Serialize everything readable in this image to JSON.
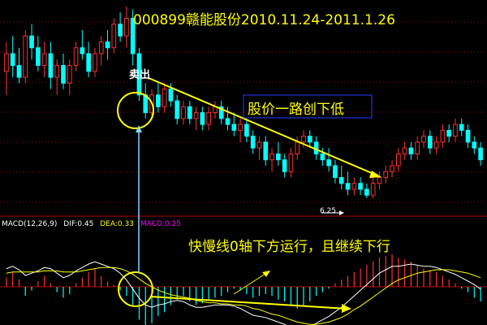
{
  "colors": {
    "background": "#000000",
    "up": "#ff3030",
    "down": "#00ffff",
    "grid": "#9b0000",
    "divider": "#b00000",
    "annotation_yellow": "#ffff00",
    "dif": "#ffffff",
    "dea": "#ffff00",
    "macd": "#ff00ff",
    "low_marker": "#ffffff",
    "vertical_link": "#7fd8ff"
  },
  "annotations": {
    "title": "000899赣能股份2010.11.24-2011.1.26",
    "sell_label": "卖出",
    "trend_label": "股价一路创下低",
    "macd_note": "快慢线0轴下方运行，且继续下行",
    "low_marker": "6.25"
  },
  "macd_header": {
    "name": "MACD(12,26,9)",
    "dif": "DIF:0.45",
    "dea": "DEA:0.33",
    "macd": "MACD:0.25"
  },
  "chart_data": [
    {
      "type": "candlestick",
      "title": "000899赣能股份2010.11.24-2011.1.26",
      "ylim": [
        6.0,
        9.5
      ],
      "annotations": [
        "卖出",
        "股价一路创下低",
        "6.25"
      ],
      "candles": [
        {
          "o": 8.4,
          "h": 8.9,
          "l": 8.0,
          "c": 8.7
        },
        {
          "o": 8.7,
          "h": 9.0,
          "l": 8.3,
          "c": 8.5
        },
        {
          "o": 8.5,
          "h": 8.8,
          "l": 8.2,
          "c": 8.3
        },
        {
          "o": 8.3,
          "h": 9.1,
          "l": 8.2,
          "c": 9.0
        },
        {
          "o": 9.0,
          "h": 9.2,
          "l": 8.6,
          "c": 8.8
        },
        {
          "o": 8.8,
          "h": 9.0,
          "l": 8.4,
          "c": 8.5
        },
        {
          "o": 8.5,
          "h": 8.9,
          "l": 8.3,
          "c": 8.7
        },
        {
          "o": 8.7,
          "h": 8.9,
          "l": 8.1,
          "c": 8.3
        },
        {
          "o": 8.3,
          "h": 8.6,
          "l": 8.0,
          "c": 8.5
        },
        {
          "o": 8.5,
          "h": 8.7,
          "l": 8.1,
          "c": 8.2
        },
        {
          "o": 8.2,
          "h": 8.6,
          "l": 8.0,
          "c": 8.5
        },
        {
          "o": 8.5,
          "h": 8.9,
          "l": 8.4,
          "c": 8.8
        },
        {
          "o": 8.8,
          "h": 9.1,
          "l": 8.6,
          "c": 8.7
        },
        {
          "o": 8.7,
          "h": 8.9,
          "l": 8.3,
          "c": 8.4
        },
        {
          "o": 8.4,
          "h": 8.8,
          "l": 8.3,
          "c": 8.7
        },
        {
          "o": 8.7,
          "h": 9.0,
          "l": 8.5,
          "c": 8.9
        },
        {
          "o": 8.9,
          "h": 9.1,
          "l": 8.6,
          "c": 8.8
        },
        {
          "o": 8.8,
          "h": 9.3,
          "l": 8.7,
          "c": 9.2
        },
        {
          "o": 9.2,
          "h": 9.4,
          "l": 8.9,
          "c": 9.0
        },
        {
          "o": 9.0,
          "h": 9.5,
          "l": 8.8,
          "c": 9.3
        },
        {
          "o": 9.3,
          "h": 9.45,
          "l": 8.5,
          "c": 8.7
        },
        {
          "o": 8.7,
          "h": 8.8,
          "l": 7.9,
          "c": 8.0
        },
        {
          "o": 8.0,
          "h": 8.2,
          "l": 7.6,
          "c": 7.7
        },
        {
          "o": 7.7,
          "h": 8.1,
          "l": 7.6,
          "c": 8.0
        },
        {
          "o": 8.0,
          "h": 8.2,
          "l": 7.7,
          "c": 7.8
        },
        {
          "o": 7.8,
          "h": 8.2,
          "l": 7.7,
          "c": 8.1
        },
        {
          "o": 8.1,
          "h": 8.2,
          "l": 7.8,
          "c": 7.9
        },
        {
          "o": 7.9,
          "h": 8.0,
          "l": 7.5,
          "c": 7.6
        },
        {
          "o": 7.6,
          "h": 7.9,
          "l": 7.5,
          "c": 7.8
        },
        {
          "o": 7.8,
          "h": 7.9,
          "l": 7.5,
          "c": 7.6
        },
        {
          "o": 7.6,
          "h": 7.8,
          "l": 7.4,
          "c": 7.7
        },
        {
          "o": 7.7,
          "h": 7.8,
          "l": 7.4,
          "c": 7.5
        },
        {
          "o": 7.5,
          "h": 7.8,
          "l": 7.4,
          "c": 7.7
        },
        {
          "o": 7.7,
          "h": 7.9,
          "l": 7.6,
          "c": 7.8
        },
        {
          "o": 7.8,
          "h": 7.9,
          "l": 7.5,
          "c": 7.6
        },
        {
          "o": 7.6,
          "h": 7.8,
          "l": 7.4,
          "c": 7.5
        },
        {
          "o": 7.5,
          "h": 7.7,
          "l": 7.3,
          "c": 7.4
        },
        {
          "o": 7.4,
          "h": 7.6,
          "l": 7.2,
          "c": 7.5
        },
        {
          "o": 7.5,
          "h": 7.6,
          "l": 7.2,
          "c": 7.3
        },
        {
          "o": 7.3,
          "h": 7.4,
          "l": 7.0,
          "c": 7.1
        },
        {
          "o": 7.1,
          "h": 7.3,
          "l": 6.9,
          "c": 7.2
        },
        {
          "o": 7.2,
          "h": 7.3,
          "l": 6.8,
          "c": 6.9
        },
        {
          "o": 6.9,
          "h": 7.1,
          "l": 6.7,
          "c": 7.0
        },
        {
          "o": 7.0,
          "h": 7.2,
          "l": 6.8,
          "c": 6.9
        },
        {
          "o": 6.9,
          "h": 7.0,
          "l": 6.6,
          "c": 6.7
        },
        {
          "o": 6.7,
          "h": 7.1,
          "l": 6.6,
          "c": 7.0
        },
        {
          "o": 7.0,
          "h": 7.3,
          "l": 6.9,
          "c": 7.2
        },
        {
          "o": 7.2,
          "h": 7.4,
          "l": 7.1,
          "c": 7.3
        },
        {
          "o": 7.3,
          "h": 7.4,
          "l": 7.1,
          "c": 7.2
        },
        {
          "o": 7.2,
          "h": 7.3,
          "l": 6.9,
          "c": 7.0
        },
        {
          "o": 7.0,
          "h": 7.1,
          "l": 6.8,
          "c": 6.9
        },
        {
          "o": 6.9,
          "h": 7.1,
          "l": 6.7,
          "c": 6.8
        },
        {
          "o": 6.8,
          "h": 6.9,
          "l": 6.5,
          "c": 6.6
        },
        {
          "o": 6.6,
          "h": 6.8,
          "l": 6.4,
          "c": 6.5
        },
        {
          "o": 6.5,
          "h": 6.7,
          "l": 6.3,
          "c": 6.4
        },
        {
          "o": 6.4,
          "h": 6.6,
          "l": 6.3,
          "c": 6.5
        },
        {
          "o": 6.5,
          "h": 6.6,
          "l": 6.3,
          "c": 6.4
        },
        {
          "o": 6.4,
          "h": 6.5,
          "l": 6.25,
          "c": 6.3
        },
        {
          "o": 6.3,
          "h": 6.6,
          "l": 6.25,
          "c": 6.5
        },
        {
          "o": 6.5,
          "h": 6.7,
          "l": 6.4,
          "c": 6.6
        },
        {
          "o": 6.6,
          "h": 6.8,
          "l": 6.5,
          "c": 6.7
        },
        {
          "o": 6.7,
          "h": 6.9,
          "l": 6.6,
          "c": 6.8
        },
        {
          "o": 6.8,
          "h": 7.1,
          "l": 6.7,
          "c": 7.0
        },
        {
          "o": 7.0,
          "h": 7.2,
          "l": 6.9,
          "c": 7.1
        },
        {
          "o": 7.1,
          "h": 7.2,
          "l": 6.9,
          "c": 7.0
        },
        {
          "o": 7.0,
          "h": 7.3,
          "l": 6.9,
          "c": 7.2
        },
        {
          "o": 7.2,
          "h": 7.4,
          "l": 7.1,
          "c": 7.3
        },
        {
          "o": 7.3,
          "h": 7.4,
          "l": 7.0,
          "c": 7.1
        },
        {
          "o": 7.1,
          "h": 7.3,
          "l": 7.0,
          "c": 7.2
        },
        {
          "o": 7.2,
          "h": 7.5,
          "l": 7.1,
          "c": 7.4
        },
        {
          "o": 7.4,
          "h": 7.5,
          "l": 7.2,
          "c": 7.3
        },
        {
          "o": 7.3,
          "h": 7.6,
          "l": 7.2,
          "c": 7.5
        },
        {
          "o": 7.5,
          "h": 7.6,
          "l": 7.3,
          "c": 7.4
        },
        {
          "o": 7.4,
          "h": 7.5,
          "l": 7.1,
          "c": 7.2
        },
        {
          "o": 7.2,
          "h": 7.3,
          "l": 7.0,
          "c": 7.1
        },
        {
          "o": 7.1,
          "h": 7.2,
          "l": 6.8,
          "c": 6.9
        }
      ]
    },
    {
      "type": "bar",
      "title": "MACD(12,26,9)",
      "annotations": [
        "快慢线0轴下方运行，且继续下行"
      ],
      "ylim": [
        -0.45,
        0.45
      ],
      "macd": [
        0.05,
        0.08,
        0.04,
        -0.05,
        -0.02,
        0.03,
        0.06,
        0.02,
        -0.03,
        -0.06,
        -0.04,
        0.02,
        0.05,
        0.08,
        0.1,
        0.06,
        0.03,
        0.01,
        -0.02,
        -0.05,
        -0.1,
        -0.18,
        -0.22,
        -0.2,
        -0.16,
        -0.14,
        -0.1,
        -0.07,
        -0.05,
        -0.08,
        -0.1,
        -0.09,
        -0.07,
        -0.06,
        -0.05,
        -0.03,
        -0.01,
        -0.02,
        -0.04,
        -0.06,
        -0.05,
        -0.04,
        -0.05,
        -0.07,
        -0.08,
        -0.1,
        -0.12,
        -0.1,
        -0.08,
        -0.05,
        -0.03,
        -0.01,
        0.02,
        0.04,
        0.06,
        0.08,
        0.1,
        0.12,
        0.14,
        0.16,
        0.17,
        0.18,
        0.16,
        0.15,
        0.14,
        0.12,
        0.1,
        0.09,
        0.08,
        0.06,
        0.04,
        0.02,
        -0.01,
        -0.03,
        -0.06,
        -0.08
      ],
      "dif": [
        0.16,
        0.18,
        0.15,
        0.1,
        0.12,
        0.14,
        0.17,
        0.16,
        0.12,
        0.08,
        0.1,
        0.14,
        0.17,
        0.2,
        0.22,
        0.2,
        0.18,
        0.16,
        0.12,
        0.06,
        -0.02,
        -0.1,
        -0.16,
        -0.18,
        -0.16,
        -0.15,
        -0.13,
        -0.12,
        -0.13,
        -0.16,
        -0.18,
        -0.18,
        -0.17,
        -0.16,
        -0.16,
        -0.16,
        -0.17,
        -0.19,
        -0.22,
        -0.25,
        -0.26,
        -0.27,
        -0.29,
        -0.31,
        -0.33,
        -0.36,
        -0.38,
        -0.37,
        -0.35,
        -0.32,
        -0.29,
        -0.26,
        -0.22,
        -0.18,
        -0.13,
        -0.08,
        -0.03,
        0.02,
        0.07,
        0.12,
        0.15,
        0.18,
        0.18,
        0.19,
        0.2,
        0.19,
        0.18,
        0.18,
        0.17,
        0.15,
        0.13,
        0.11,
        0.08,
        0.05,
        0.02,
        -0.02
      ],
      "dea": [
        0.12,
        0.13,
        0.13,
        0.13,
        0.13,
        0.13,
        0.14,
        0.14,
        0.14,
        0.13,
        0.13,
        0.13,
        0.14,
        0.15,
        0.16,
        0.17,
        0.17,
        0.17,
        0.16,
        0.14,
        0.11,
        0.07,
        0.03,
        0.0,
        -0.03,
        -0.05,
        -0.07,
        -0.08,
        -0.09,
        -0.1,
        -0.12,
        -0.13,
        -0.14,
        -0.14,
        -0.15,
        -0.15,
        -0.16,
        -0.16,
        -0.17,
        -0.19,
        -0.2,
        -0.22,
        -0.24,
        -0.25,
        -0.27,
        -0.29,
        -0.31,
        -0.32,
        -0.33,
        -0.33,
        -0.32,
        -0.31,
        -0.29,
        -0.27,
        -0.24,
        -0.2,
        -0.17,
        -0.13,
        -0.09,
        -0.05,
        -0.01,
        0.03,
        0.06,
        0.08,
        0.1,
        0.12,
        0.13,
        0.14,
        0.15,
        0.15,
        0.15,
        0.14,
        0.13,
        0.12,
        0.1,
        0.08
      ]
    }
  ]
}
